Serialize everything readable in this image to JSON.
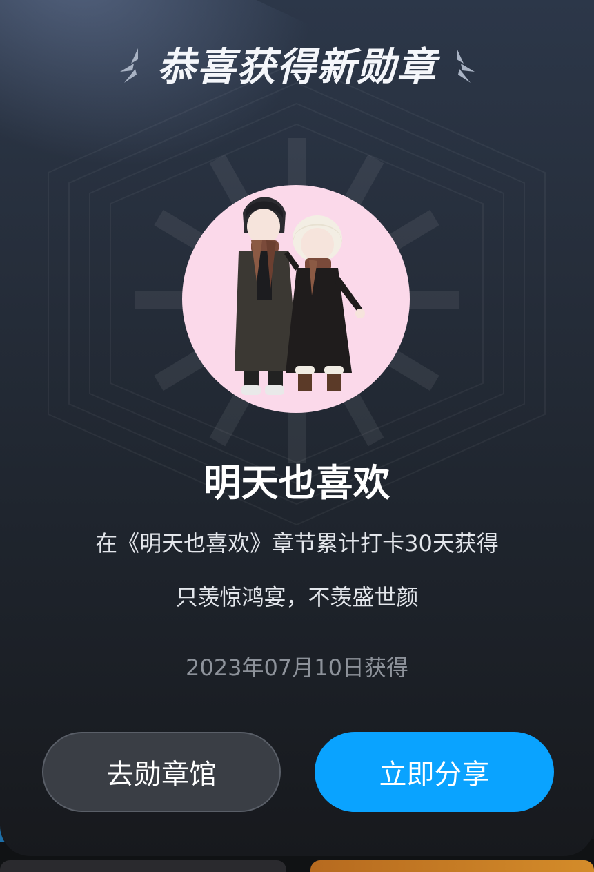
{
  "modal": {
    "title": "恭喜获得新勋章",
    "badge_name": "明天也喜欢",
    "description": "在《明天也喜欢》章节累计打卡30天获得",
    "quote": "只羡惊鸿宴，不羡盛世颜",
    "earned_date": "2023年07月10日获得",
    "buttons": {
      "gallery_label": "去勋章馆",
      "share_label": "立即分享"
    }
  },
  "colors": {
    "accent_blue": "#0aa3ff",
    "badge_bg": "#fbd9ea",
    "secondary_button": "#3a3e45"
  }
}
